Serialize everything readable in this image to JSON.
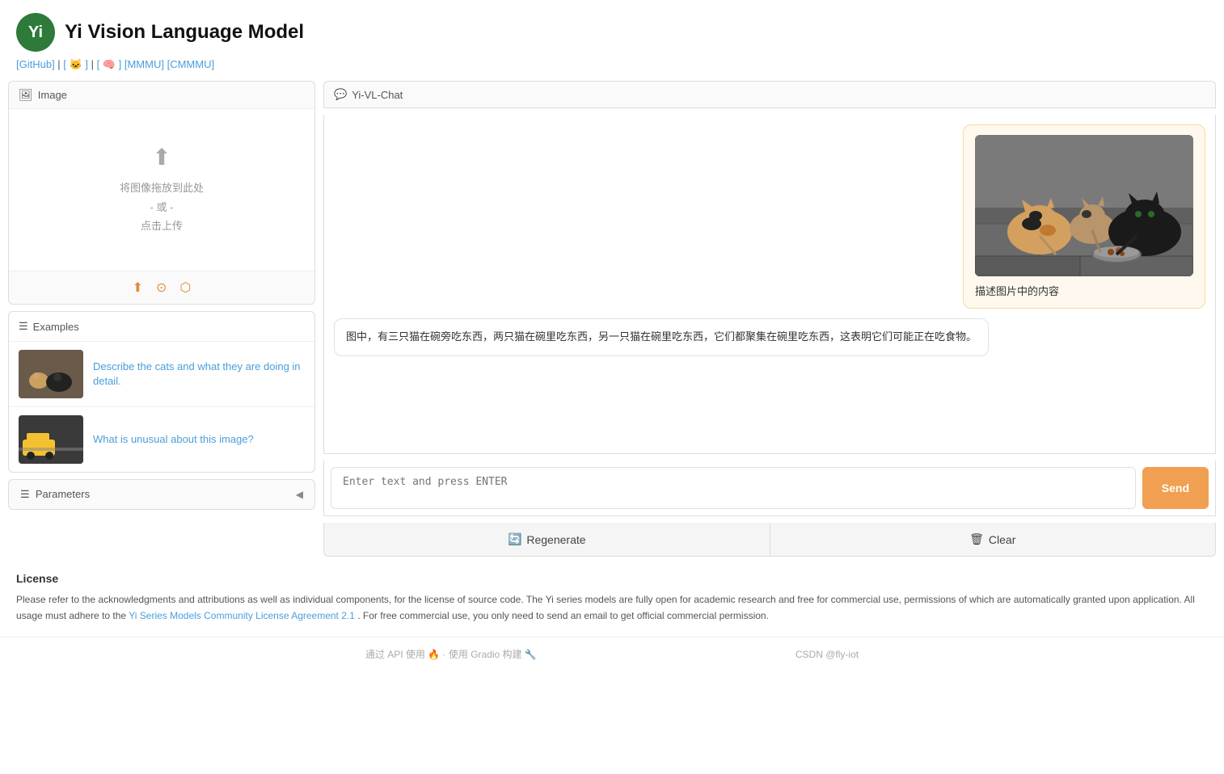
{
  "header": {
    "logo_text": "Yi",
    "title": "Yi Vision Language Model",
    "links": [
      {
        "label": "[GitHub]",
        "href": "#"
      },
      {
        "label": "[ 🐱 ]",
        "href": "#"
      },
      {
        "label": "[ 🧠 ]",
        "href": "#"
      },
      {
        "label": "[MMMU]",
        "href": "#"
      },
      {
        "label": "[CMMMU]",
        "href": "#"
      }
    ]
  },
  "left_panel": {
    "image_tab_label": "Image",
    "upload_prompt_line1": "将图像拖放到此处",
    "upload_prompt_line2": "- 或 -",
    "upload_prompt_line3": "点击上传",
    "examples_label": "Examples",
    "examples": [
      {
        "id": 1,
        "thumb_class": "thumb-cats",
        "text": "Describe the cats and what they are doing in detail."
      },
      {
        "id": 2,
        "thumb_class": "thumb-taxi",
        "text": "What is unusual about this image?"
      }
    ],
    "params_label": "Parameters"
  },
  "chat_panel": {
    "tab_label": "Yi-VL-Chat",
    "user_message_text": "描述图片中的内容",
    "ai_response_text": "图中，有三只猫在碗旁吃东西，两只猫在碗里吃东西，另一只猫在碗里吃东西，它们都聚集在碗里吃东西，这表明它们可能正在吃食物。",
    "input_placeholder": "Enter text and press ENTER",
    "send_button_label": "Send",
    "regenerate_button_label": "Regenerate",
    "clear_button_label": "Clear"
  },
  "license": {
    "heading": "License",
    "body": "Please refer to the acknowledgments and attributions as well as individual components, for the license of source code. The Yi series models are fully open for academic research and free for commercial use, permissions of which are automatically granted upon application. All usage must adhere to the",
    "link_text": "Yi Series Models Community License Agreement 2.1",
    "body2": ". For free commercial use, you only need to send an email to get official commercial permission."
  },
  "footer": {
    "text": "通过 API 使用 🔥 · 使用 Gradio 构建 🔧"
  },
  "brand_footer": "CSDN @fly-iot"
}
